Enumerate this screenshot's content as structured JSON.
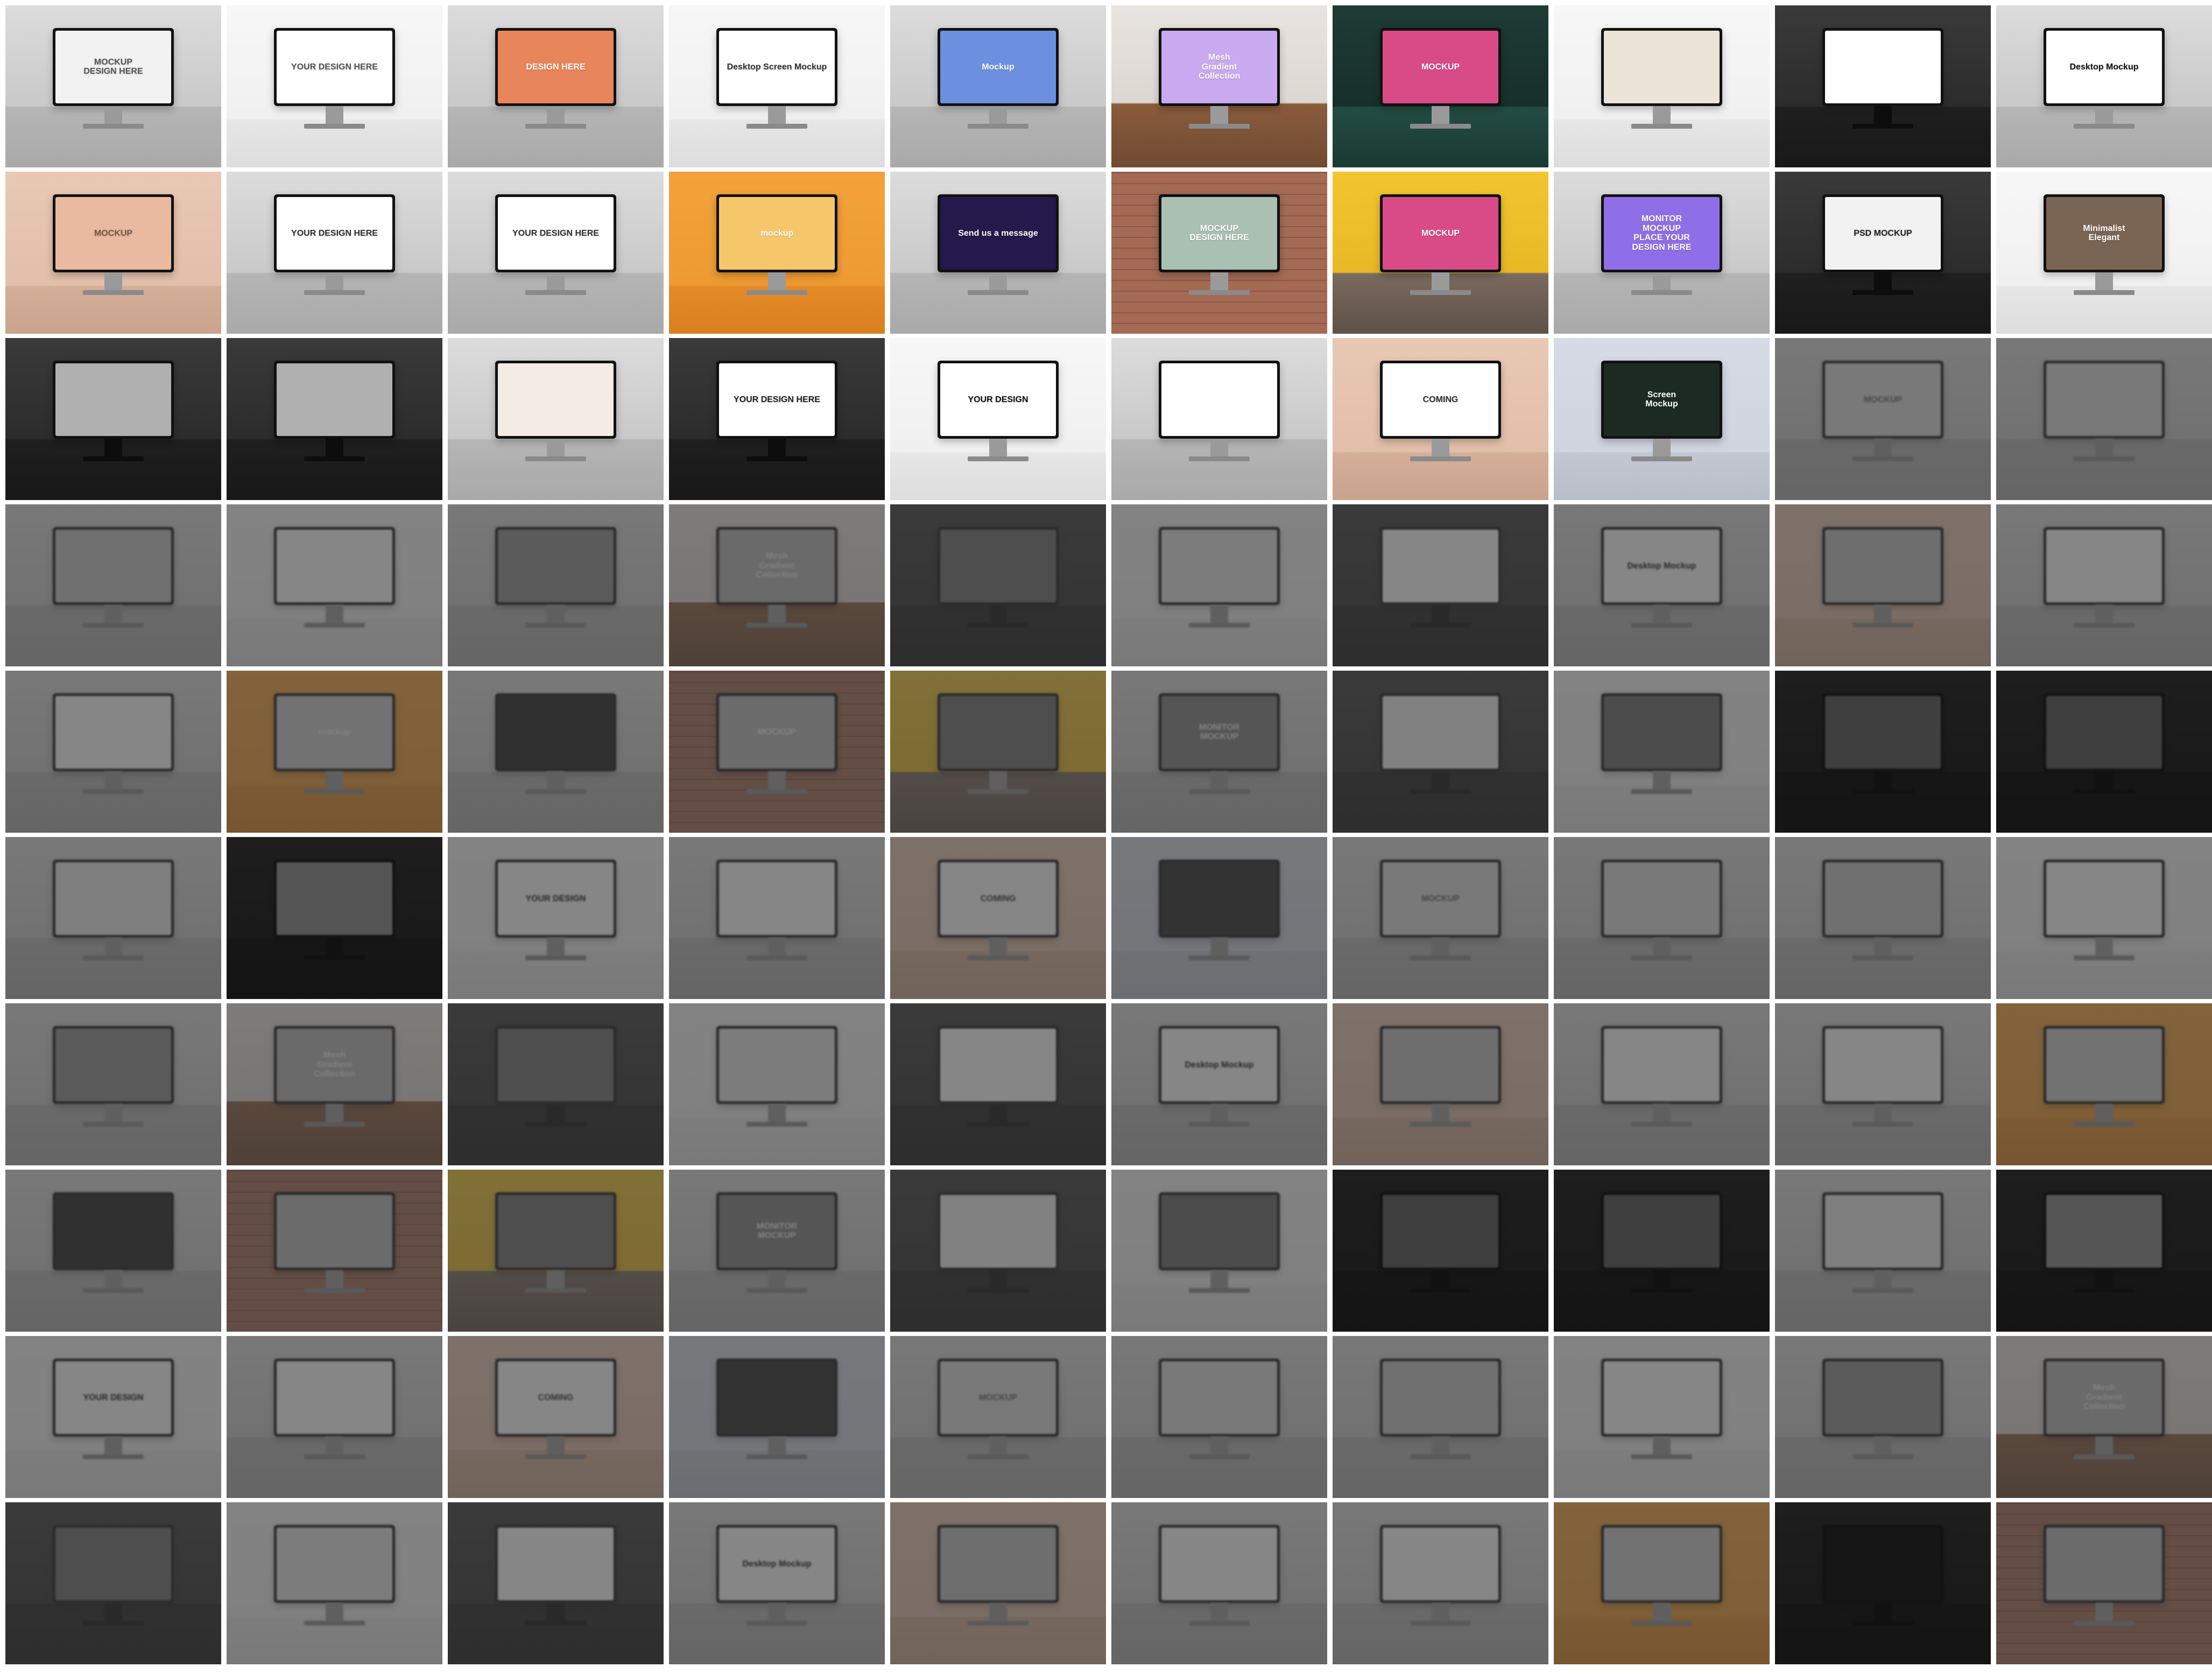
{
  "grid": {
    "columns": 10,
    "rows": 10,
    "tiles": [
      {
        "screen": "MOCKUP\nDESIGN HERE",
        "screen_bg": "#f2f2f2",
        "screen_fg": "#555555",
        "tone": "light",
        "faded": false
      },
      {
        "screen": "YOUR DESIGN HERE",
        "screen_bg": "#ffffff",
        "screen_fg": "#555555",
        "tone": "white",
        "faded": false
      },
      {
        "screen": "DESIGN HERE",
        "screen_bg": "#e9855a",
        "screen_fg": "#ffffff",
        "tone": "light",
        "faded": false
      },
      {
        "screen": "Desktop Screen Mockup",
        "screen_bg": "#ffffff",
        "screen_fg": "#333333",
        "tone": "white",
        "faded": false
      },
      {
        "screen": "Mockup",
        "screen_bg": "#6d8fe0",
        "screen_fg": "#ffffff",
        "tone": "light",
        "faded": false
      },
      {
        "screen": "Mesh\nGradient\nCollection",
        "screen_bg": "#c9a9f0",
        "screen_fg": "#ffffff",
        "tone": "wood",
        "faded": false
      },
      {
        "screen": "MOCKUP",
        "screen_bg": "#d94b86",
        "screen_fg": "#ffffff",
        "tone": "teal",
        "faded": false
      },
      {
        "screen": "",
        "screen_bg": "#ede4d8",
        "screen_fg": "#333333",
        "tone": "white",
        "faded": false
      },
      {
        "screen": "",
        "screen_bg": "#ffffff",
        "screen_fg": "#333333",
        "tone": "dark",
        "faded": false
      },
      {
        "screen": "Desktop Mockup",
        "screen_bg": "#ffffff",
        "screen_fg": "#111111",
        "tone": "light",
        "faded": false
      },
      {
        "screen": "MOCKUP",
        "screen_bg": "#e9b9a0",
        "screen_fg": "#7a5a4a",
        "tone": "beige",
        "faded": false
      },
      {
        "screen": "YOUR DESIGN HERE",
        "screen_bg": "#ffffff",
        "screen_fg": "#333333",
        "tone": "light",
        "faded": false
      },
      {
        "screen": "YOUR DESIGN HERE",
        "screen_bg": "#ffffff",
        "screen_fg": "#333333",
        "tone": "light",
        "faded": false
      },
      {
        "screen": "mockup",
        "screen_bg": "#f6c66a",
        "screen_fg": "#ffffff",
        "tone": "orange",
        "faded": false
      },
      {
        "screen": "Send us a message",
        "screen_bg": "#23194a",
        "screen_fg": "#ffffff",
        "tone": "light",
        "faded": false
      },
      {
        "screen": "MOCKUP\nDESIGN HERE",
        "screen_bg": "#a9c0b2",
        "screen_fg": "#ffffff",
        "tone": "brick",
        "faded": false
      },
      {
        "screen": "MOCKUP",
        "screen_bg": "#d94b86",
        "screen_fg": "#ffffff",
        "tone": "yellow",
        "faded": false
      },
      {
        "screen": "MONITOR\nMOCKUP\nPLACE YOUR\nDESIGN HERE",
        "screen_bg": "#8f6fe8",
        "screen_fg": "#ffffff",
        "tone": "light",
        "faded": false
      },
      {
        "screen": "PSD MOCKUP",
        "screen_bg": "#f2f2f2",
        "screen_fg": "#222222",
        "tone": "dark",
        "faded": false
      },
      {
        "screen": "Minimalist\nElegant",
        "screen_bg": "#7a6554",
        "screen_fg": "#ffffff",
        "tone": "white",
        "faded": false
      },
      {
        "screen": "",
        "screen_bg": "#b0b0b0",
        "screen_fg": "#ffffff",
        "tone": "dark",
        "faded": false
      },
      {
        "screen": "",
        "screen_bg": "#b0b0b0",
        "screen_fg": "#ffffff",
        "tone": "dark",
        "faded": false
      },
      {
        "screen": "",
        "screen_bg": "#f2ece4",
        "screen_fg": "#333333",
        "tone": "light",
        "faded": false
      },
      {
        "screen": "YOUR DESIGN HERE",
        "screen_bg": "#ffffff",
        "screen_fg": "#222222",
        "tone": "dark",
        "faded": false
      },
      {
        "screen": "YOUR DESIGN",
        "screen_bg": "#ffffff",
        "screen_fg": "#111111",
        "tone": "white",
        "faded": false
      },
      {
        "screen": "",
        "screen_bg": "#ffffff",
        "screen_fg": "#333333",
        "tone": "light",
        "faded": false
      },
      {
        "screen": "COMING",
        "screen_bg": "#ffffff",
        "screen_fg": "#333333",
        "tone": "beige",
        "faded": false
      },
      {
        "screen": "Screen\nMockup",
        "screen_bg": "#1c2a22",
        "screen_fg": "#ffffff",
        "tone": "cool",
        "faded": false
      },
      {
        "screen": "MOCKUP",
        "screen_bg": "#dddddd",
        "screen_fg": "#666666",
        "tone": "light",
        "faded": true
      },
      {
        "screen": "",
        "screen_bg": "#dddddd",
        "screen_fg": "#666666",
        "tone": "light",
        "faded": true
      },
      {
        "screen": "",
        "screen_bg": "#e0c0a8",
        "screen_fg": "#ffffff",
        "tone": "light",
        "faded": true
      },
      {
        "screen": "",
        "screen_bg": "#ffffff",
        "screen_fg": "#333333",
        "tone": "white",
        "faded": true
      },
      {
        "screen": "",
        "screen_bg": "#6d8fe0",
        "screen_fg": "#ffffff",
        "tone": "light",
        "faded": true
      },
      {
        "screen": "Mesh\nGradient\nCollection",
        "screen_bg": "#c9a9f0",
        "screen_fg": "#ffffff",
        "tone": "wood",
        "faded": true
      },
      {
        "screen": "",
        "screen_bg": "#d94b86",
        "screen_fg": "#ffffff",
        "tone": "dark",
        "faded": true
      },
      {
        "screen": "",
        "screen_bg": "#ede4d8",
        "screen_fg": "#333333",
        "tone": "white",
        "faded": true
      },
      {
        "screen": "",
        "screen_bg": "#ffffff",
        "screen_fg": "#333333",
        "tone": "dark",
        "faded": true
      },
      {
        "screen": "Desktop Mockup",
        "screen_bg": "#ffffff",
        "screen_fg": "#111111",
        "tone": "light",
        "faded": true
      },
      {
        "screen": "",
        "screen_bg": "#e9b9a0",
        "screen_fg": "#7a5a4a",
        "tone": "beige",
        "faded": true
      },
      {
        "screen": "",
        "screen_bg": "#ffffff",
        "screen_fg": "#333333",
        "tone": "light",
        "faded": true
      },
      {
        "screen": "",
        "screen_bg": "#ffffff",
        "screen_fg": "#333333",
        "tone": "light",
        "faded": true
      },
      {
        "screen": "mockup",
        "screen_bg": "#f6c66a",
        "screen_fg": "#ffffff",
        "tone": "orange",
        "faded": true
      },
      {
        "screen": "",
        "screen_bg": "#23194a",
        "screen_fg": "#ffffff",
        "tone": "light",
        "faded": true
      },
      {
        "screen": "MOCKUP",
        "screen_bg": "#a9c0b2",
        "screen_fg": "#ffffff",
        "tone": "brick",
        "faded": true
      },
      {
        "screen": "",
        "screen_bg": "#d94b86",
        "screen_fg": "#ffffff",
        "tone": "yellow",
        "faded": true
      },
      {
        "screen": "MONITOR\nMOCKUP",
        "screen_bg": "#8f6fe8",
        "screen_fg": "#ffffff",
        "tone": "light",
        "faded": true
      },
      {
        "screen": "",
        "screen_bg": "#f2f2f2",
        "screen_fg": "#222222",
        "tone": "dark",
        "faded": true
      },
      {
        "screen": "",
        "screen_bg": "#7a6554",
        "screen_fg": "#ffffff",
        "tone": "white",
        "faded": true
      },
      {
        "screen": "",
        "screen_bg": "#b0b0b0",
        "screen_fg": "#ffffff",
        "tone": "dark",
        "faded": true,
        "dim": true
      },
      {
        "screen": "",
        "screen_bg": "#b0b0b0",
        "screen_fg": "#ffffff",
        "tone": "dark",
        "faded": true,
        "dim": true
      },
      {
        "screen": "",
        "screen_bg": "#f2ece4",
        "screen_fg": "#333333",
        "tone": "light",
        "faded": true
      },
      {
        "screen": "",
        "screen_bg": "#ffffff",
        "screen_fg": "#222222",
        "tone": "dark",
        "faded": true,
        "dim": true
      },
      {
        "screen": "YOUR DESIGN",
        "screen_bg": "#ffffff",
        "screen_fg": "#111111",
        "tone": "white",
        "faded": true
      },
      {
        "screen": "",
        "screen_bg": "#ffffff",
        "screen_fg": "#333333",
        "tone": "light",
        "faded": true
      },
      {
        "screen": "COMING",
        "screen_bg": "#ffffff",
        "screen_fg": "#333333",
        "tone": "beige",
        "faded": true
      },
      {
        "screen": "",
        "screen_bg": "#1c2a22",
        "screen_fg": "#ffffff",
        "tone": "cool",
        "faded": true
      },
      {
        "screen": "MOCKUP",
        "screen_bg": "#dddddd",
        "screen_fg": "#666666",
        "tone": "light",
        "faded": true
      },
      {
        "screen": "",
        "screen_bg": "#dddddd",
        "screen_fg": "#666666",
        "tone": "light",
        "faded": true
      },
      {
        "screen": "",
        "screen_bg": "#e0c0a8",
        "screen_fg": "#ffffff",
        "tone": "light",
        "faded": true
      },
      {
        "screen": "",
        "screen_bg": "#ffffff",
        "screen_fg": "#333333",
        "tone": "white",
        "faded": true
      },
      {
        "screen": "",
        "screen_bg": "#6d8fe0",
        "screen_fg": "#ffffff",
        "tone": "light",
        "faded": true
      },
      {
        "screen": "Mesh\nGradient\nCollection",
        "screen_bg": "#c9a9f0",
        "screen_fg": "#ffffff",
        "tone": "wood",
        "faded": true
      },
      {
        "screen": "",
        "screen_bg": "#d94b86",
        "screen_fg": "#ffffff",
        "tone": "dark",
        "faded": true
      },
      {
        "screen": "",
        "screen_bg": "#ede4d8",
        "screen_fg": "#333333",
        "tone": "white",
        "faded": true
      },
      {
        "screen": "",
        "screen_bg": "#ffffff",
        "screen_fg": "#333333",
        "tone": "dark",
        "faded": true
      },
      {
        "screen": "Desktop Mockup",
        "screen_bg": "#ffffff",
        "screen_fg": "#111111",
        "tone": "light",
        "faded": true
      },
      {
        "screen": "",
        "screen_bg": "#e9b9a0",
        "screen_fg": "#7a5a4a",
        "tone": "beige",
        "faded": true
      },
      {
        "screen": "",
        "screen_bg": "#ffffff",
        "screen_fg": "#333333",
        "tone": "light",
        "faded": true
      },
      {
        "screen": "",
        "screen_bg": "#ffffff",
        "screen_fg": "#333333",
        "tone": "light",
        "faded": true
      },
      {
        "screen": "",
        "screen_bg": "#f6c66a",
        "screen_fg": "#ffffff",
        "tone": "orange",
        "faded": true
      },
      {
        "screen": "",
        "screen_bg": "#23194a",
        "screen_fg": "#ffffff",
        "tone": "light",
        "faded": true
      },
      {
        "screen": "",
        "screen_bg": "#a9c0b2",
        "screen_fg": "#ffffff",
        "tone": "brick",
        "faded": true
      },
      {
        "screen": "",
        "screen_bg": "#d94b86",
        "screen_fg": "#ffffff",
        "tone": "yellow",
        "faded": true
      },
      {
        "screen": "MONITOR\nMOCKUP",
        "screen_bg": "#8f6fe8",
        "screen_fg": "#ffffff",
        "tone": "light",
        "faded": true
      },
      {
        "screen": "",
        "screen_bg": "#f2f2f2",
        "screen_fg": "#222222",
        "tone": "dark",
        "faded": true
      },
      {
        "screen": "",
        "screen_bg": "#7a6554",
        "screen_fg": "#ffffff",
        "tone": "white",
        "faded": true
      },
      {
        "screen": "",
        "screen_bg": "#b0b0b0",
        "screen_fg": "#ffffff",
        "tone": "dark",
        "faded": true,
        "dim": true
      },
      {
        "screen": "",
        "screen_bg": "#b0b0b0",
        "screen_fg": "#ffffff",
        "tone": "dark",
        "faded": true,
        "dim": true
      },
      {
        "screen": "",
        "screen_bg": "#f2ece4",
        "screen_fg": "#333333",
        "tone": "light",
        "faded": true
      },
      {
        "screen": "",
        "screen_bg": "#ffffff",
        "screen_fg": "#222222",
        "tone": "dark",
        "faded": true,
        "dim": true
      },
      {
        "screen": "YOUR DESIGN",
        "screen_bg": "#ffffff",
        "screen_fg": "#111111",
        "tone": "white",
        "faded": true
      },
      {
        "screen": "",
        "screen_bg": "#ffffff",
        "screen_fg": "#333333",
        "tone": "light",
        "faded": true
      },
      {
        "screen": "COMING",
        "screen_bg": "#ffffff",
        "screen_fg": "#333333",
        "tone": "beige",
        "faded": true
      },
      {
        "screen": "",
        "screen_bg": "#1c2a22",
        "screen_fg": "#ffffff",
        "tone": "cool",
        "faded": true
      },
      {
        "screen": "MOCKUP",
        "screen_bg": "#dddddd",
        "screen_fg": "#666666",
        "tone": "light",
        "faded": true
      },
      {
        "screen": "",
        "screen_bg": "#dddddd",
        "screen_fg": "#666666",
        "tone": "light",
        "faded": true
      },
      {
        "screen": "",
        "screen_bg": "#e0c0a8",
        "screen_fg": "#ffffff",
        "tone": "light",
        "faded": true
      },
      {
        "screen": "",
        "screen_bg": "#ffffff",
        "screen_fg": "#333333",
        "tone": "white",
        "faded": true
      },
      {
        "screen": "",
        "screen_bg": "#6d8fe0",
        "screen_fg": "#ffffff",
        "tone": "light",
        "faded": true
      },
      {
        "screen": "Mesh\nGradient\nCollection",
        "screen_bg": "#c9a9f0",
        "screen_fg": "#ffffff",
        "tone": "wood",
        "faded": true
      },
      {
        "screen": "",
        "screen_bg": "#d94b86",
        "screen_fg": "#ffffff",
        "tone": "dark",
        "faded": true
      },
      {
        "screen": "",
        "screen_bg": "#ede4d8",
        "screen_fg": "#333333",
        "tone": "white",
        "faded": true
      },
      {
        "screen": "",
        "screen_bg": "#ffffff",
        "screen_fg": "#333333",
        "tone": "dark",
        "faded": true
      },
      {
        "screen": "Desktop Mockup",
        "screen_bg": "#ffffff",
        "screen_fg": "#111111",
        "tone": "light",
        "faded": true
      },
      {
        "screen": "",
        "screen_bg": "#e9b9a0",
        "screen_fg": "#7a5a4a",
        "tone": "beige",
        "faded": true
      },
      {
        "screen": "",
        "screen_bg": "#ffffff",
        "screen_fg": "#333333",
        "tone": "light",
        "faded": true
      },
      {
        "screen": "",
        "screen_bg": "#ffffff",
        "screen_fg": "#333333",
        "tone": "light",
        "faded": true
      },
      {
        "screen": "",
        "screen_bg": "#f6c66a",
        "screen_fg": "#ffffff",
        "tone": "orange",
        "faded": true
      },
      {
        "screen": "",
        "screen_bg": "#23194a",
        "screen_fg": "#ffffff",
        "tone": "dark",
        "faded": true,
        "dim": true
      },
      {
        "screen": "",
        "screen_bg": "#a9c0b2",
        "screen_fg": "#ffffff",
        "tone": "brick",
        "faded": true
      }
    ]
  }
}
